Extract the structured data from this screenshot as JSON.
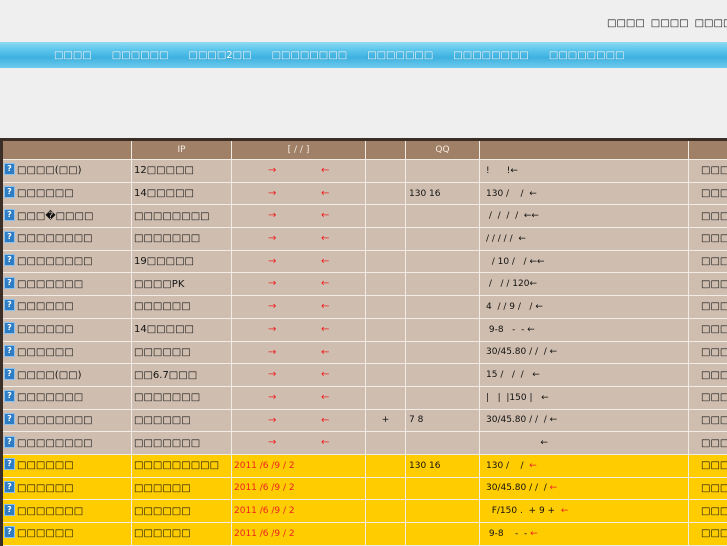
{
  "header": {
    "links": [
      "□□□□",
      "□□□□",
      "□□□□"
    ]
  },
  "nav": {
    "items": [
      "□□□□",
      "□□□□□□",
      "□□□□2□□",
      "□□□□□□□□",
      "□□□□□□□",
      "□□□□□□□□",
      "□□□□□□□□"
    ]
  },
  "table": {
    "headers": [
      "",
      "IP",
      "[ / /  ]",
      "",
      "QQ",
      "",
      ""
    ],
    "arrow_right": "→",
    "arrow_left": "←",
    "rows": [
      {
        "style": "n",
        "name": "□□□□(□□)",
        "ip": "12□□□□□",
        "time": "",
        "c4": "",
        "qq": "",
        "desc": "!      !",
        "arrow": "←",
        "last": "□□□□"
      },
      {
        "style": "n",
        "name": "□□□□□□",
        "ip": "14□□□□□",
        "time": "",
        "c4": "",
        "qq": "130  16",
        "desc": "130 /    /  ",
        "arrow": "←",
        "last": "□□□□"
      },
      {
        "style": "n",
        "name": "□□□�□□□□",
        "ip": "□□□□□□□□",
        "time": "",
        "c4": "",
        "qq": "",
        "desc": " /  /  /  /  ",
        "arrow": "←←",
        "last": "□□□□"
      },
      {
        "style": "n",
        "name": "□□□□□□□□",
        "ip": "□□□□□□□",
        "time": "",
        "c4": "",
        "qq": "",
        "desc": "/ / / / /  ",
        "arrow": "←",
        "last": "□□□□"
      },
      {
        "style": "n",
        "name": "□□□□□□□□",
        "ip": "19□□□□□",
        "time": "",
        "c4": "",
        "qq": "",
        "desc": "  / 10 /   / ",
        "arrow": "←←",
        "last": "□□□□"
      },
      {
        "style": "n",
        "name": "□□□□□□□",
        "ip": "□□□□PK",
        "time": "",
        "c4": "",
        "qq": "",
        "desc": " /   / / 120",
        "arrow": "←",
        "last": "□□□□"
      },
      {
        "style": "n",
        "name": "□□□□□□",
        "ip": "□□□□□□",
        "time": "",
        "c4": "",
        "qq": "",
        "desc": "4  / / 9 /   / ",
        "arrow": "←",
        "last": "□□□□"
      },
      {
        "style": "n",
        "name": "□□□□□□",
        "ip": "14□□□□□",
        "time": "",
        "c4": "",
        "qq": "",
        "desc": " 9-8   -  - ",
        "arrow": "←",
        "last": "□□□□"
      },
      {
        "style": "n",
        "name": "□□□□□□",
        "ip": "□□□□□□",
        "time": "",
        "c4": "",
        "qq": "",
        "desc": "30/45.80 / /  / ",
        "arrow": "←",
        "last": "□□□□"
      },
      {
        "style": "n",
        "name": "□□□□(□□)",
        "ip": "□□6.7□□□",
        "time": "",
        "c4": "",
        "qq": "",
        "desc": "15 /   /  /   ",
        "arrow": "←",
        "last": "□□□□"
      },
      {
        "style": "n",
        "name": "□□□□□□□",
        "ip": "□□□□□□□",
        "time": "",
        "c4": "",
        "qq": "",
        "desc": "|   |  |150 |   ",
        "arrow": "←",
        "last": "□□□□"
      },
      {
        "style": "n",
        "name": "□□□□□□□□",
        "ip": "□□□□□□",
        "time": "",
        "c4": "+",
        "qq": "  7 8",
        "desc": "30/45.80 / /  / ",
        "arrow": "←",
        "last": "□□□□"
      },
      {
        "style": "n",
        "name": "□□□□□□□□",
        "ip": "□□□□□□□",
        "time": "",
        "c4": "",
        "qq": "",
        "desc": "                   ",
        "arrow": "←",
        "last": "□□□□"
      },
      {
        "style": "y",
        "name": "□□□□□□",
        "ip": "□□□□□□□□□",
        "time": "2011 /6 /9 / 2",
        "c4": "",
        "qq": "130  16",
        "desc": "130 /    /  ",
        "arrow": "←",
        "last": "□□□□"
      },
      {
        "style": "y",
        "name": "□□□□□□",
        "ip": "□□□□□□",
        "time": "2011 /6 /9 / 2",
        "c4": "",
        "qq": "",
        "desc": "30/45.80 / /  / ",
        "arrow": "←",
        "last": "□□□□"
      },
      {
        "style": "y",
        "name": "□□□□□□□",
        "ip": "□□□□□□",
        "time": "2011 /6 /9 / 2",
        "c4": "",
        "qq": "",
        "desc": "  F/150 .  + 9 +  ",
        "arrow": "←",
        "last": "□□□□"
      },
      {
        "style": "y",
        "name": "□□□□□□",
        "ip": "□□□□□□",
        "time": "2011 /6 /9 / 2",
        "c4": "",
        "qq": "",
        "desc": " 9-8    -  - ",
        "arrow": "←",
        "last": "□□□□"
      }
    ]
  }
}
